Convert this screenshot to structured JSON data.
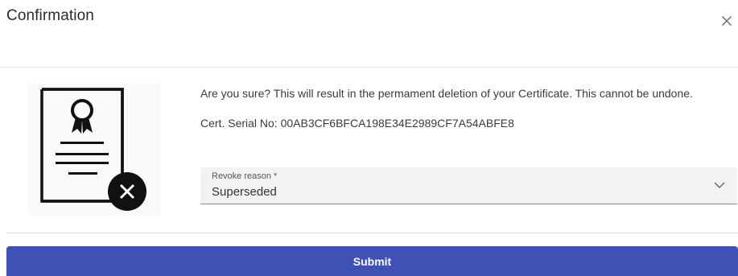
{
  "dialog": {
    "title": "Confirmation",
    "close_icon": "close-icon"
  },
  "illustration": {
    "icon": "certificate-icon",
    "badge_icon": "delete-x-icon"
  },
  "content": {
    "message": "Are you sure? This will result in the permament deletion of your Certificate. This cannot be undone.",
    "serial_label": "Cert. Serial No:",
    "serial_value": "00AB3CF6BFCA198E34E2989CF7A54ABFE8"
  },
  "revoke_reason": {
    "label": "Revoke reason *",
    "value": "Superseded",
    "chevron_icon": "chevron-down-icon"
  },
  "footer": {
    "submit_label": "Submit"
  },
  "colors": {
    "primary": "#3f51b5",
    "field_bg": "#f2f2f2",
    "divider": "#e3e3e3"
  }
}
